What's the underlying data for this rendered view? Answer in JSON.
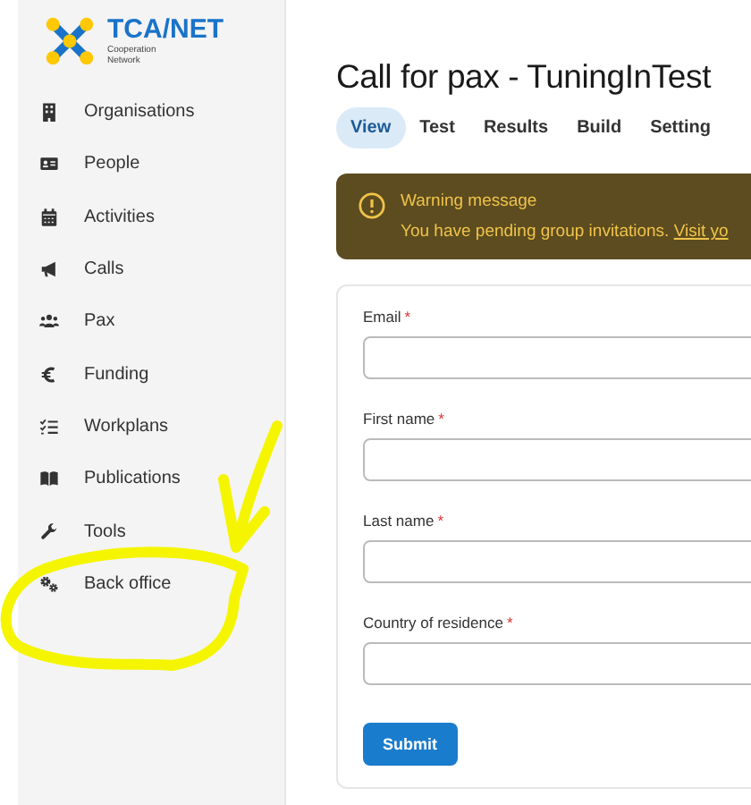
{
  "logo": {
    "name": "TCA/NET",
    "tagline": "Cooperation Network"
  },
  "sidebar": {
    "items": [
      {
        "label": "Organisations",
        "selected": false
      },
      {
        "label": "People",
        "selected": false
      },
      {
        "label": "Activities",
        "selected": false
      },
      {
        "label": "Calls",
        "selected": false
      },
      {
        "label": "Pax",
        "selected": false
      },
      {
        "label": "Funding",
        "selected": false
      },
      {
        "label": "Workplans",
        "selected": false
      },
      {
        "label": "Publications",
        "selected": false
      },
      {
        "label": "Tools",
        "selected": false
      },
      {
        "label": "Back office",
        "selected": false
      }
    ]
  },
  "page": {
    "title": "Call for pax - TuningInTest",
    "tabs": [
      {
        "label": "View",
        "selected": true
      },
      {
        "label": "Test",
        "selected": false
      },
      {
        "label": "Results",
        "selected": false
      },
      {
        "label": "Build",
        "selected": false
      },
      {
        "label": "Setting",
        "selected": false
      }
    ],
    "warning": {
      "title": "Warning message",
      "text": "You have pending group invitations.",
      "link": "Visit yo"
    },
    "form": {
      "fields": [
        {
          "label": "Email",
          "required_mark": "*"
        },
        {
          "label": "First name",
          "required_mark": "*"
        },
        {
          "label": "Last name",
          "required_mark": "*"
        },
        {
          "label": "Country of residence",
          "required_mark": "*"
        }
      ],
      "submit": "Submit"
    }
  }
}
